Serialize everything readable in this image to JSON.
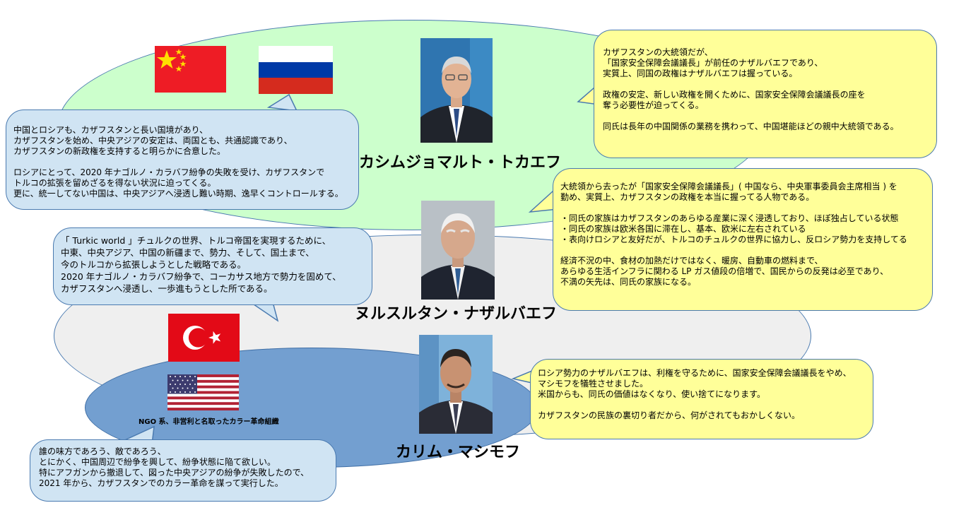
{
  "people": {
    "tokayev": {
      "name": "カシムジョマルト・トカエフ"
    },
    "nazarbayev": {
      "name": "ヌルスルタン・ナザルバエフ"
    },
    "masimov": {
      "name": "カリム・マシモフ"
    }
  },
  "labels": {
    "ngo": "NGO 系、非営利と名取ったカラー革命組織"
  },
  "bubbles": {
    "china_russia": "中国とロシアも、カザフスタンと長い国境があり、\nカザフスタンを始め、中央アジアの安定は、両国とも、共通認識であり、\nカザフスタンの新政権を支持すると明らかに合意した。\n\nロシアにとって、2020 年ナゴルノ・カラバフ紛争の失敗を受け、カザフスタンで\nトルコの拡張を留めざるを得ない状況に迫ってくる。\n更に、統一してない中国は、中央アジアへ浸透し難い時期、逸早くコントロールする。",
    "turkic": "「 Turkic world 」チュルクの世界、トルコ帝国を実現するために、\n中東、中央アジア、中国の新疆まで、勢力、そして、国土まで、\n今のトルコから拡張しようとした戦略である。\n2020 年ナゴルノ・カラバフ紛争で、コーカサス地方で勢力を固めて、\nカザフスタンへ浸透し、一歩進もうとした所である。",
    "tokayev": "カザフスタンの大統領だが、\n「国家安全保障会議議長」が前任のナザルバエフであり、\n実質上、同国の政権はナザルバエフは握っている。\n\n政権の安定、新しい政権を開くために、国家安全保障会議議長の座を\n奪う必要性が迫ってくる。\n\n同氏は長年の中国関係の業務を携わって、中国堪能ほどの親中大統領である。",
    "nazarbayev": "大統領から去ったが「国家安全保障会議議長」( 中国なら、中央軍事委員会主席相当 ) を\n勤め、実質上、カザフスタンの政権を本当に握ってる人物である。\n\n・同氏の家族はカザフスタンのあらゆる産業に深く浸透しており、ほぼ独占している状態\n・同氏の家族は欧米各国に滞在し、基本、欧米に左右されている\n・表向けロシアと友好だが、トルコのチュルクの世界に協力し、反ロシア勢力を支持してる\n\n経済不況の中、食材の加熱だけではなく、暖房、自動車の燃料まで、\nあらゆる生活インフラに関わる LP ガス値段の倍増で、国民からの反発は必至であり、\n不満の矢先は、同氏の家族になる。",
    "masimov": "ロシア勢力のナザルバエフは、利権を守るために、国家安全保障会議議長をやめ、\nマシモフを犠牲させました。\n米国からも、同氏の価値はなくなり、使い捨てになります。\n\nカザフスタンの民族の裏切り者だから、何がされてもおかしくない。",
    "ngo": "誰の味方であろう、敵であろう、\nとにかく、中国周辺で紛争を興して、紛争状態に陥て欲しい。\n特にアフガンから撤退して、図った中央アジアの紛争が失敗したので、\n2021 年から、カザフスタンでのカラー革命を謀って実行した。"
  },
  "flags": {
    "china": "china-flag-icon",
    "russia": "russia-flag-icon",
    "turkey": "turkey-flag-icon",
    "usa": "usa-flag-icon"
  },
  "colors": {
    "green_region": "#ccffcc",
    "gray_region": "#efefef",
    "blue_region": "#739fd0",
    "note_blue": "#d0e4f3",
    "note_yellow": "#ffff99"
  }
}
